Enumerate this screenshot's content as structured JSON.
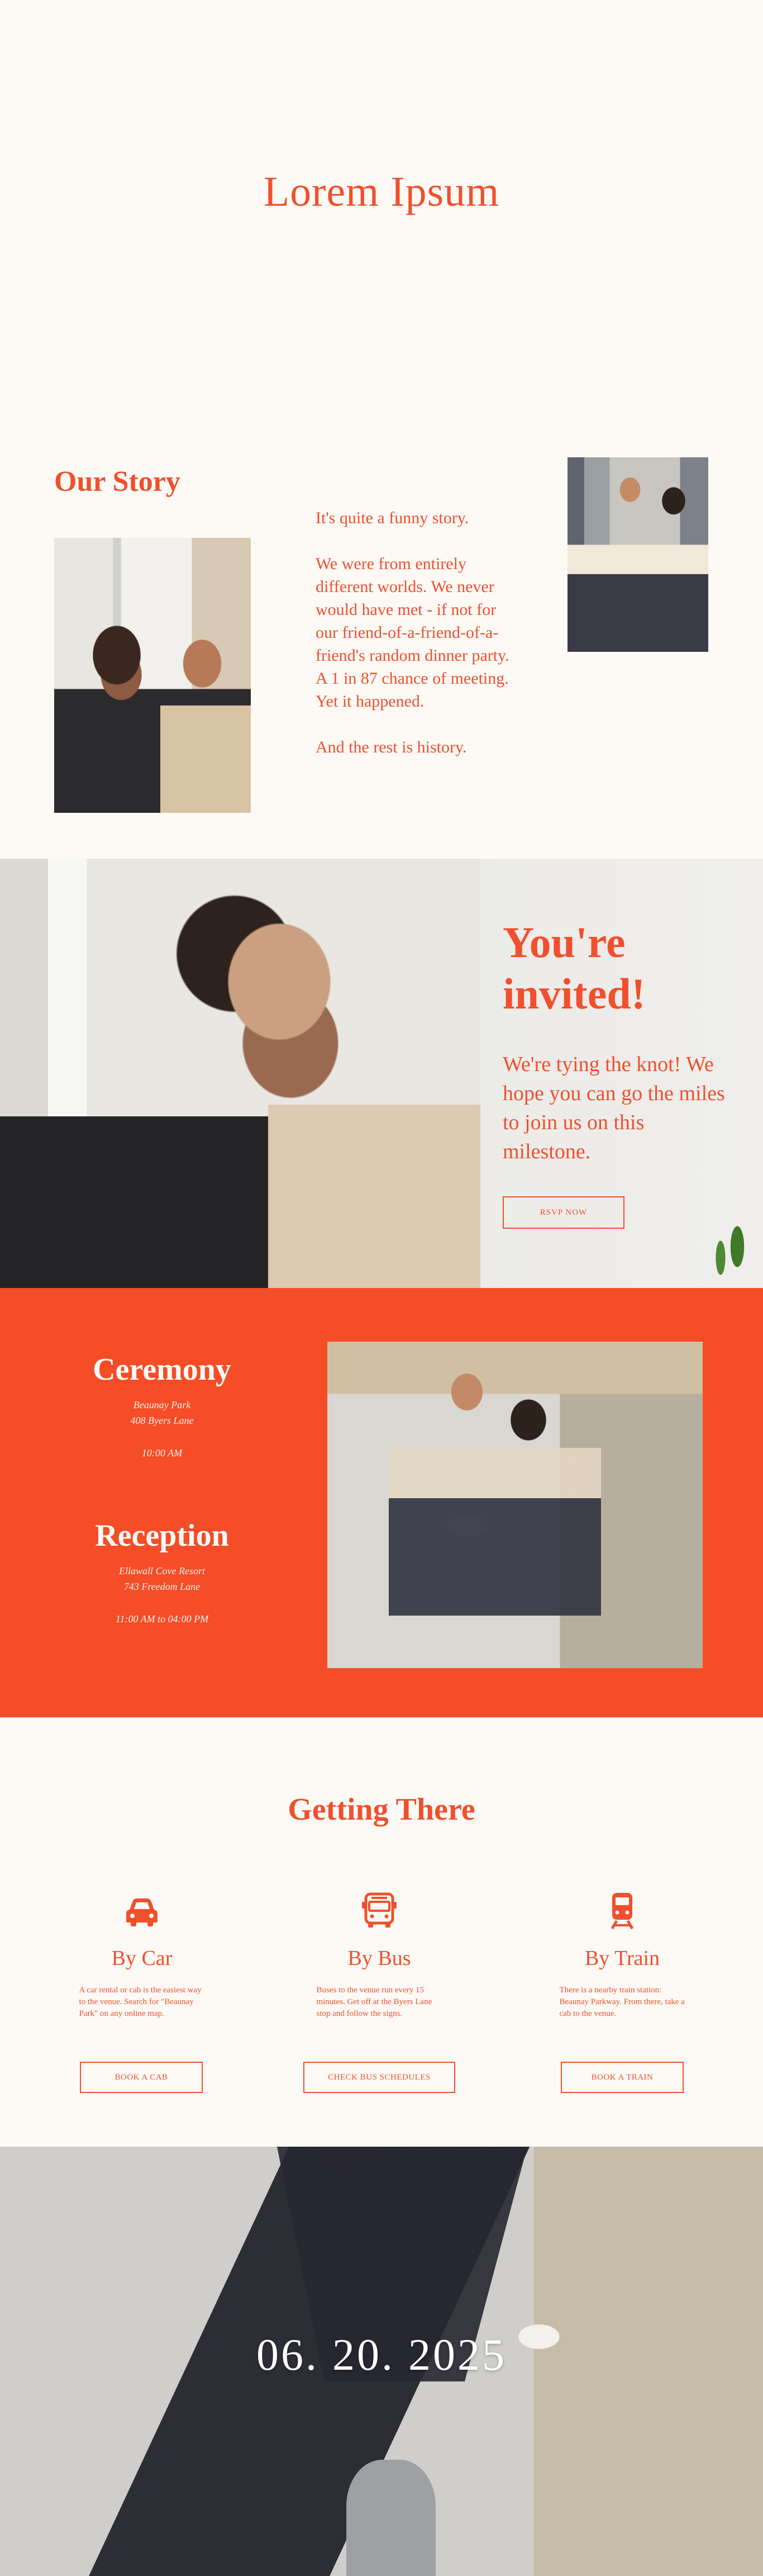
{
  "hero": {
    "title": "Lorem Ipsum"
  },
  "story": {
    "heading": "Our Story",
    "paragraphs": [
      "It's quite a funny story.",
      "We were from entirely different worlds. We never would have met - if not for our friend-of-a-friend-of-a-friend's random dinner party. A 1 in 87 chance of meeting. Yet it happened.",
      "And the rest is history."
    ]
  },
  "invite": {
    "heading": "You're invited!",
    "text": "We're tying the knot! We hope you can go the miles to join us on this milestone.",
    "rsvp_label": "RSVP NOW"
  },
  "ceremony": {
    "title": "Ceremony",
    "venue": "Beaunay Park",
    "address": "408 Byers Lane",
    "time": "10:00 AM"
  },
  "reception": {
    "title": "Reception",
    "venue": "Ellawall Cove Resort",
    "address": "743 Freedom Lane",
    "time": "11:00 AM to 04:00 PM"
  },
  "getting_there": {
    "heading": "Getting There",
    "options": [
      {
        "title": "By Car",
        "icon": "car-icon",
        "description": "A car rental or cab is the easiest way to the venue. Search for \"Beaunay Park\" on any online map.",
        "button": "BOOK A CAB"
      },
      {
        "title": "By Bus",
        "icon": "bus-icon",
        "description": "Buses to the venue run every 15 minutes. Get off at the Byers Lane stop and follow the signs.",
        "button": "CHECK BUS SCHEDULES"
      },
      {
        "title": "By Train",
        "icon": "train-icon",
        "description": "There is a nearby train station: Beaunay Parkway. From there, take a cab to the venue.",
        "button": "BOOK A TRAIN"
      }
    ]
  },
  "footer": {
    "date": "06. 20. 2025"
  },
  "colors": {
    "accent": "#f0502d",
    "event_band": "#f44d27",
    "background": "#fdfaf6"
  }
}
